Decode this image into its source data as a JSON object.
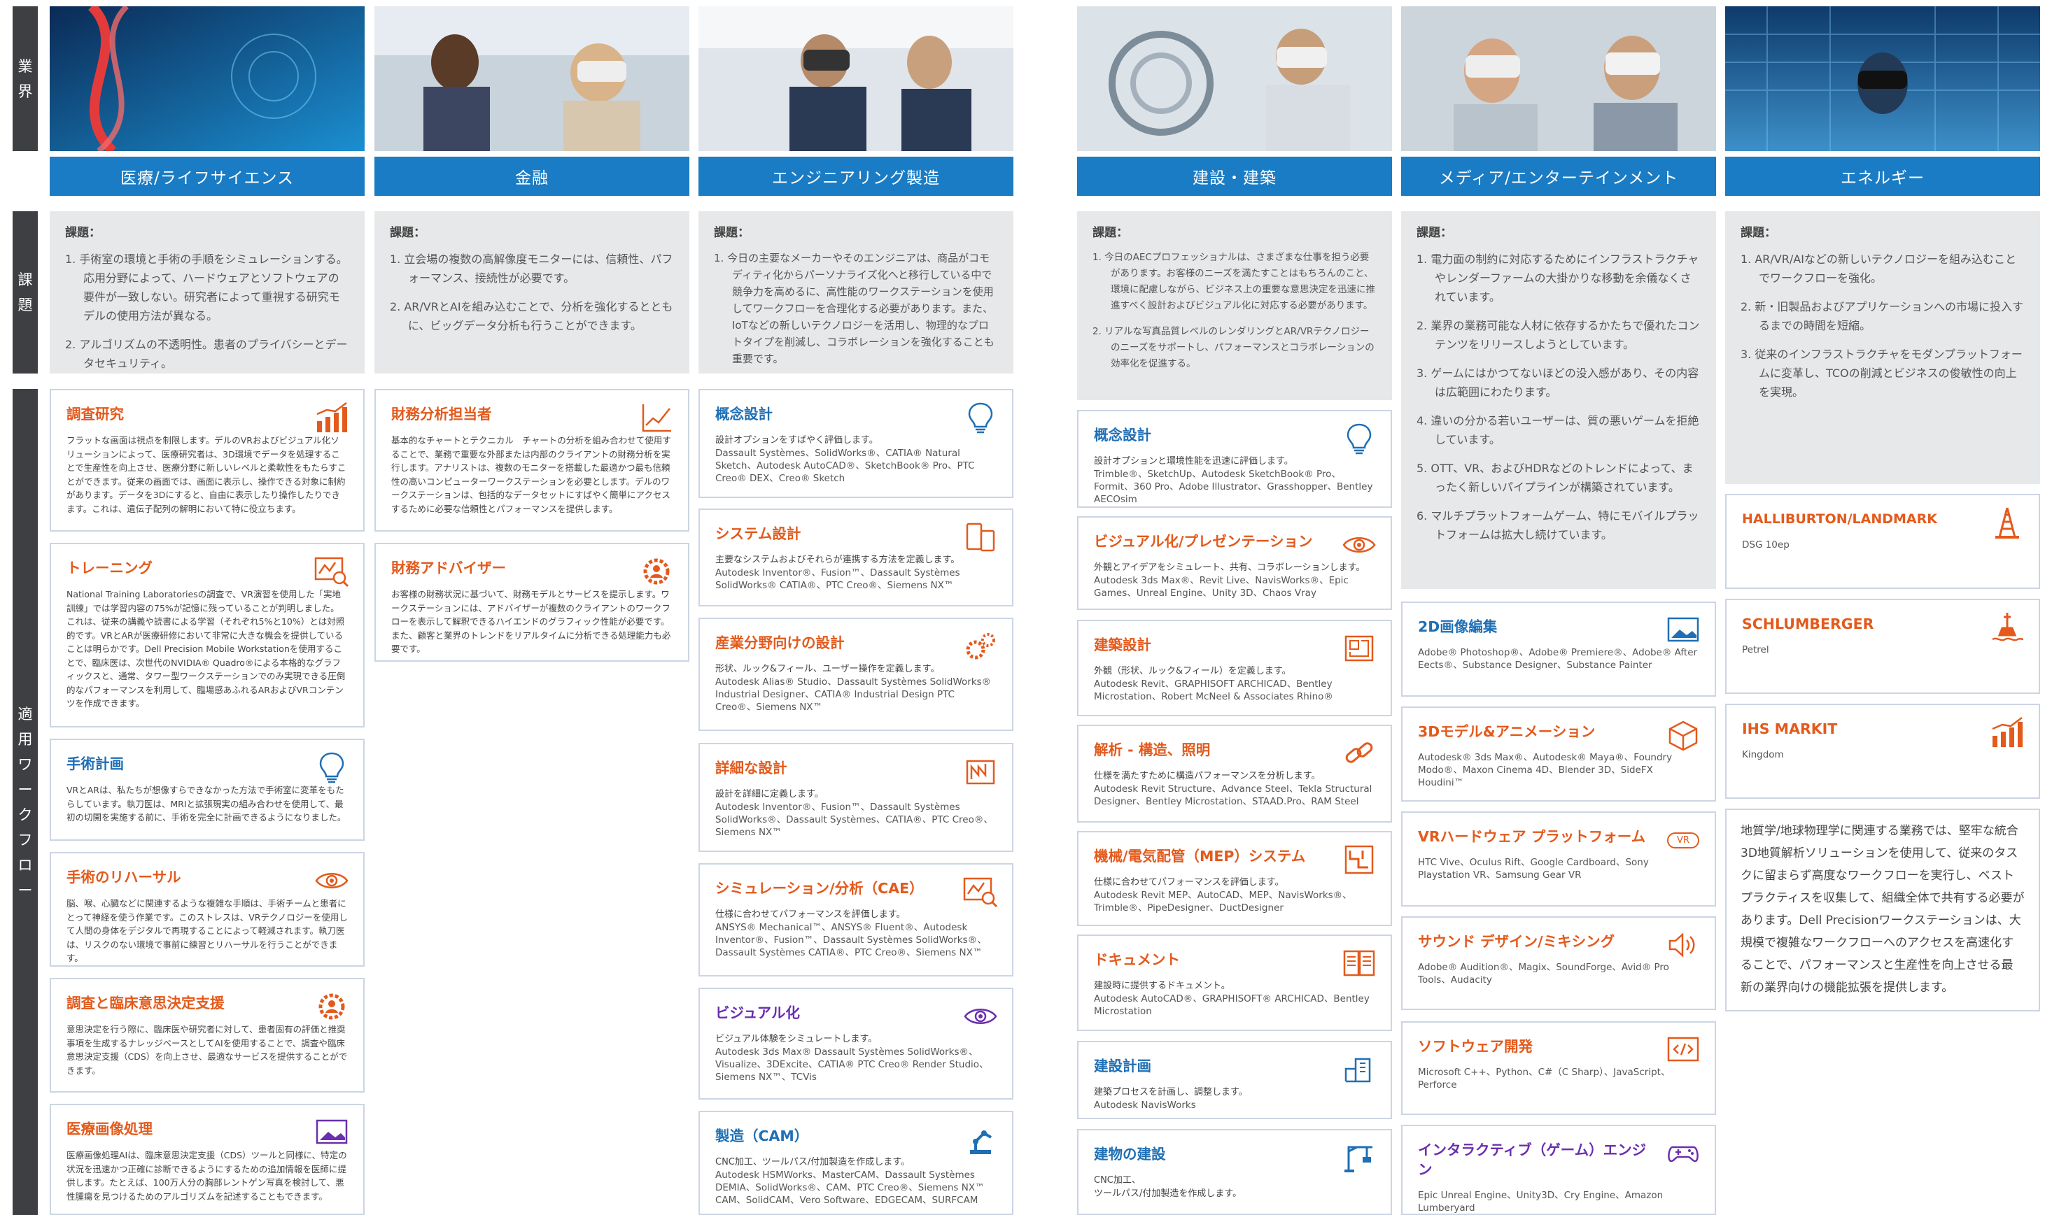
{
  "sidebar": {
    "industry": [
      "業",
      "界"
    ],
    "challenges": [
      "課",
      "題"
    ],
    "workflows": [
      "適",
      "用",
      "ワ",
      "ー",
      "ク",
      "フ",
      "ロ",
      "ー"
    ]
  },
  "columns": [
    {
      "title": "医療/ライフサイエンス",
      "challenge_heading": "課題：",
      "challenges": [
        "1.  手術室の環境と手術の手順をシミュレーションする。応用分野によって、ハードウェアとソフトウェアの要件が一致しない。研究者によって重視する研究モデルの使用方法が異なる。",
        "2.  アルゴリズムの不透明性。患者のプライバシーとデータセキュリティ。"
      ],
      "cards": [
        {
          "title": "調査研究",
          "icon": "bar-chart-icon",
          "body": "フラットな画面は視点を制限します。デルのVRおよびビジュアル化ソリューションによって、医療研究者は、3D環境でデータを処理することで生産性を向上させ、医療分野に新しいレベルと柔軟性をもたらすことができます。従来の画面では、画面に表示し、操作できる対象に制約があります。データを3Dにすると、自由に表示したり操作したりできます。これは、遺伝子配列の解明において特に役立ちます。"
        },
        {
          "title": "トレーニング",
          "icon": "analytics-search-icon",
          "body": "National Training Laboratoriesの調査で、VR演習を使用した「実地訓練」では学習内容の75%が記憶に残っていることが判明しました。これは、従来の講義や読書による学習（それぞれ5%と10%）とは対照的です。VRとARが医療研修において非常に大きな機会を提供していることは明らかです。Dell Precision Mobile Workstationを使用することで、臨床医は、次世代のNVIDIA® Quadro®による本格的なグラフィックスと、通常、タワー型ワークステーションでのみ実現できる圧倒的なパフォーマンスを利用して、臨場感あふれるARおよびVRコンテンツを作成できます。"
        },
        {
          "title": "手術計画",
          "icon": "lightbulb-icon",
          "body": "VRとARは、私たちが想像すらできなかった方法で手術室に変革をもたらしています。執刀医は、MRIと拡張現実の組み合わせを使用して、最初の切開を実施する前に、手術を完全に計画できるようになりました。"
        },
        {
          "title": "手術のリハーサル",
          "icon": "eye-icon",
          "body": "脳、喉、心臓などに関連するような複雑な手順は、手術チームと患者にとって神経を使う作業です。このストレスは、VRテクノロジーを使用して人間の身体をデジタルで再現することによって軽減されます。執刀医は、リスクのない環境で事前に練習とリハーサルを行うことができます。"
        },
        {
          "title": "調査と臨床意思決定支援",
          "icon": "gear-person-icon",
          "body": "意思決定を行う際に、臨床医や研究者に対して、患者固有の評価と推奨事項を生成するナレッジベースとしてAIを使用することで、調査や臨床意思決定支援（CDS）を向上させ、最適なサービスを提供することができます。"
        },
        {
          "title": "医療画像処理",
          "icon": "image-icon",
          "body": "医療画像処理AIは、臨床意思決定支援（CDS）ツールと同様に、特定の状況を迅速かつ正確に診断できるようにするための追加情報を医師に提供します。たとえば、100万人分の胸部レントゲン写真を検討して、悪性腫瘍を見つけるためのアルゴリズムを記述することもできます。"
        }
      ]
    },
    {
      "title": "金融",
      "challenge_heading": "課題：",
      "challenges": [
        "1.  立会場の複数の高解像度モニターには、信頼性、パフォーマンス、接続性が必要です。",
        "2.  AR/VRとAIを組み込むことで、分析を強化するとともに、ビッグデータ分析も行うことができます。"
      ],
      "cards": [
        {
          "title": "財務分析担当者",
          "icon": "line-chart-icon",
          "body": "基本的なチャートとテクニカル　チャートの分析を組み合わせて使用することで、業務で重要な外部または内部のクライアントの財務分析を実行します。アナリストは、複数のモニターを搭載した最適かつ最も信頼性の高いコンピューターワークステーションを必要とします。デルのワークステーションは、包括的なデータセットにすばやく簡単にアクセスするために必要な信頼性とパフォーマンスを提供します。"
        },
        {
          "title": "財務アドバイザー",
          "icon": "gear-person-icon",
          "body": "お客様の財務状況に基づいて、財務モデルとサービスを提示します。ワークステーションには、アドバイザーが複数のクライアントのワークフローを表示して解釈できるハイエンドのグラフィック性能が必要です。また、顧客と業界のトレンドをリアルタイムに分析できる処理能力も必要です。"
        }
      ]
    },
    {
      "title": "エンジニアリング製造",
      "challenge_heading": "課題：",
      "challenges": [
        "1.  今日の主要なメーカーやそのエンジニアは、商品がコモディティ化からパーソナライズ化へと移行している中で競争力を高めるに、高性能のワークステーションを使用してワークフローを合理化する必要があります。また、IoTなどの新しいテクノロジーを活用し、物理的なプロトタイプを削減し、コラボレーションを強化することも重要です。"
      ],
      "cards": [
        {
          "title": "概念設計",
          "icon": "lightbulb-icon",
          "desc": "設計オプションをすばやく評価します。",
          "software": "Dassault Systèmes、SolidWorks®、CATIA® Natural Sketch、Autodesk AutoCAD®、SketchBook® Pro、PTC Creo® DEX、Creo® Sketch"
        },
        {
          "title": "システム設計",
          "icon": "devices-icon",
          "desc": "主要なシステムおよびそれらが連携する方法を定義します。",
          "software": "Autodesk Inventor®、Fusion™、Dassault Systèmes SolidWorks® CATIA®、PTC Creo®、Siemens NX™"
        },
        {
          "title": "産業分野向けの設計",
          "icon": "gears-icon",
          "desc": "形状、ルック&フィール、ユーザー操作を定義します。",
          "software": "Autodesk Alias® Studio、Dassault Systèmes SolidWorks® Industrial Designer、CATIA® Industrial Design PTC Creo®、Siemens NX™"
        },
        {
          "title": "詳細な設計",
          "icon": "blueprint-icon",
          "desc": "設計を詳細に定義します。",
          "software": "Autodesk Inventor®、Fusion™、Dassault Systèmes SolidWorks®、Dassault Systèmes、CATIA®、PTC Creo®、Siemens NX™"
        },
        {
          "title": "シミュレーション/分析（CAE）",
          "icon": "analytics-search-icon",
          "desc": "仕様に合わせてパフォーマンスを評価します。",
          "software": "ANSYS® Mechanical™、ANSYS® Fluent®、Autodesk Inventor®、Fusion™、Dassault Systèmes SolidWorks®、Dassault Systèmes CATIA®、PTC Creo®、Siemens NX™"
        },
        {
          "title": "ビジュアル化",
          "icon": "eye-icon",
          "desc": "ビジュアル体験をシミュレートします。",
          "software": "Autodesk 3ds Max® Dassault Systèmes SolidWorks®、Visualize、3DExcite、CATIA® PTC Creo® Render Studio、Siemens NX™、TCVis"
        },
        {
          "title": "製造（CAM）",
          "icon": "robot-arm-icon",
          "desc": "CNC加工、ツールパス/付加製造を作成します。",
          "software": "Autodesk HSMWorks、MasterCAM、Dassault Systèmes DEMIA、SolidWorks®、CAM、PTC Creo®、Siemens NX™ CAM、SolidCAM、Vero Software、EDGECAM、SURFCAM"
        }
      ]
    },
    {
      "title": "建設・建築",
      "challenge_heading": "課題：",
      "challenges": [
        "1.  今日のAECプロフェッショナルは、さまざまな仕事を担う必要があります。お客様のニーズを満たすことはもちろんのこと、環境に配慮しながら、ビジネス上の重要な意思決定を迅速に推進すべく設計およびビジュアル化に対応する必要があります。",
        "2.  リアルな写真品質レベルのレンダリングとAR/VRテクノロジーのニーズをサポートし、パフォーマンスとコラボレーションの効率化を促進する。"
      ],
      "cards": [
        {
          "title": "概念設計",
          "icon": "lightbulb-icon",
          "desc": "設計オプションと環境性能を迅速に評価します。",
          "software": "Trimble®、SketchUp、Autodesk SketchBook® Pro、Formit、360 Pro、Adobe Illustrator、Grasshopper、Bentley AECOsim"
        },
        {
          "title": "ビジュアル化/プレゼンテーション",
          "icon": "eye-icon",
          "desc": "外観とアイデアをシミュレート、共有、コラボレーションします。",
          "software": "Autodesk 3ds Max®、Revit Live、NavisWorks®、Epic Games、Unreal Engine、Unity 3D、Chaos Vray"
        },
        {
          "title": "建築設計",
          "icon": "floorplan-icon",
          "desc": "外観（形状、ルック&フィール）を定義します。",
          "software": "Autodesk Revit、GRAPHISOFT ARCHICAD、Bentley Microstation、Robert McNeel & Associates Rhino®"
        },
        {
          "title": "解析 - 構造、照明",
          "icon": "chain-icon",
          "desc": "仕様を満たすために構造パフォーマンスを分析します。",
          "software": "Autodesk Revit Structure、Advance Steel、Tekla Structural Designer、Bentley Microstation、STAAD.Pro、RAM Steel"
        },
        {
          "title": "機械/電気配管（MEP）システム",
          "icon": "piping-icon",
          "desc": "仕様に合わせてパフォーマンスを評価します。",
          "software": "Autodesk Revit MEP、AutoCAD、MEP、NavisWorks®、Trimble®、PipeDesigner、DuctDesigner"
        },
        {
          "title": "ドキュメント",
          "icon": "document-icon",
          "desc": "建設時に提供するドキュメント。",
          "software": "Autodesk AutoCAD®、GRAPHISOFT® ARCHICAD、Bentley Microstation"
        },
        {
          "title": "建設計画",
          "icon": "building-plan-icon",
          "desc": "建築プロセスを計画し、調整します。",
          "software": "Autodesk NavisWorks"
        },
        {
          "title": "建物の建設",
          "icon": "crane-icon",
          "desc": "CNC加工、",
          "software": "ツールパス/付加製造を作成します。"
        }
      ]
    },
    {
      "title": "メディア/エンターテインメント",
      "challenge_heading": "課題：",
      "challenges": [
        "1.  電力面の制約に対応するためにインフラストラクチャやレンダーファームの大掛かりな移動を余儀なくされています。",
        "2.  業界の業務可能な人材に依存するかたちで優れたコンテンツをリリースしようとしています。",
        "3.  ゲームにはかつてないほどの没入感があり、その内容は広範囲にわたります。",
        "4.  違いの分かる若いユーザーは、質の悪いゲームを拒絶しています。",
        "5.  OTT、VR、およびHDRなどのトレンドによって、まったく新しいパイプラインが構築されています。",
        "6.  マルチプラットフォームゲーム、特にモバイルプラットフォームは拡大し続けています。"
      ],
      "cards": [
        {
          "title": "2D画像編集",
          "icon": "image-icon",
          "software": "Adobe® Photoshop®、Adobe® Premiere®、Adobe® After Eects®、Substance Designer、Substance Painter"
        },
        {
          "title": "3Dモデル&アニメーション",
          "icon": "cube-icon",
          "software": "Autodesk® 3ds Max®、Autodesk® Maya®、Foundry Modo®、Maxon Cinema 4D、Blender 3D、SideFX Houdini™"
        },
        {
          "title": "VRハードウェア プラットフォーム",
          "icon": "vr-badge-icon",
          "badge": "VR",
          "software": "HTC Vive、Oculus Rift、Google Cardboard、Sony Playstation VR、Samsung Gear VR"
        },
        {
          "title": "サウンド デザイン/ミキシング",
          "icon": "speaker-icon",
          "software": "Adobe® Audition®、Magix、SoundForge、Avid® Pro Tools、Audacity"
        },
        {
          "title": "ソフトウェア開発",
          "icon": "code-icon",
          "software": "Microsoft C++、Python、C#（C Sharp）、JavaScript、Perforce"
        },
        {
          "title": "インタラクティブ（ゲーム）エンジン",
          "icon": "gamepad-icon",
          "software": "Epic Unreal Engine、Unity3D、Cry Engine、Amazon Lumberyard"
        }
      ]
    },
    {
      "title": "エネルギー",
      "challenge_heading": "課題：",
      "challenges": [
        "1.  AR/VR/AIなどの新しいテクノロジーを組み込むことでワークフローを強化。",
        "2.  新・旧製品およびアプリケーションへの市場に投入するまでの時間を短縮。",
        "3.  従来のインフラストラクチャをモダンプラットフォームに変革し、TCOの削減とビジネスの俊敏性の向上を実現。"
      ],
      "cards": [
        {
          "title": "HALLIBURTON/LANDMARK",
          "icon": "oil-rig-icon",
          "software": "DSG 10ep"
        },
        {
          "title": "SCHLUMBERGER",
          "icon": "drill-platform-icon",
          "software": "Petrel"
        },
        {
          "title": "IHS MARKIT",
          "icon": "bar-chart-icon",
          "software": "Kingdom"
        }
      ],
      "summary": "地質学/地球物理学に関連する業務では、堅牢な統合3D地質解析ソリューションを使用して、従来のタスクに留まらず高度なワークフローを実行し、ベストプラクティスを収集して、組織全体で共有する必要があります。Dell Precisionワークステーションは、大規模で複雑なワークフローへのアクセスを高速化することで、パフォーマンスと生産性を向上させる最新の業界向けの機能拡張を提供します。"
    }
  ],
  "colors": {
    "blue_bar": "#1a7cc4",
    "sidebar": "#3d3f42",
    "orange": "#e35a1c",
    "card_border": "#ccd5e3",
    "challenge_bg": "#e7e8e9"
  }
}
